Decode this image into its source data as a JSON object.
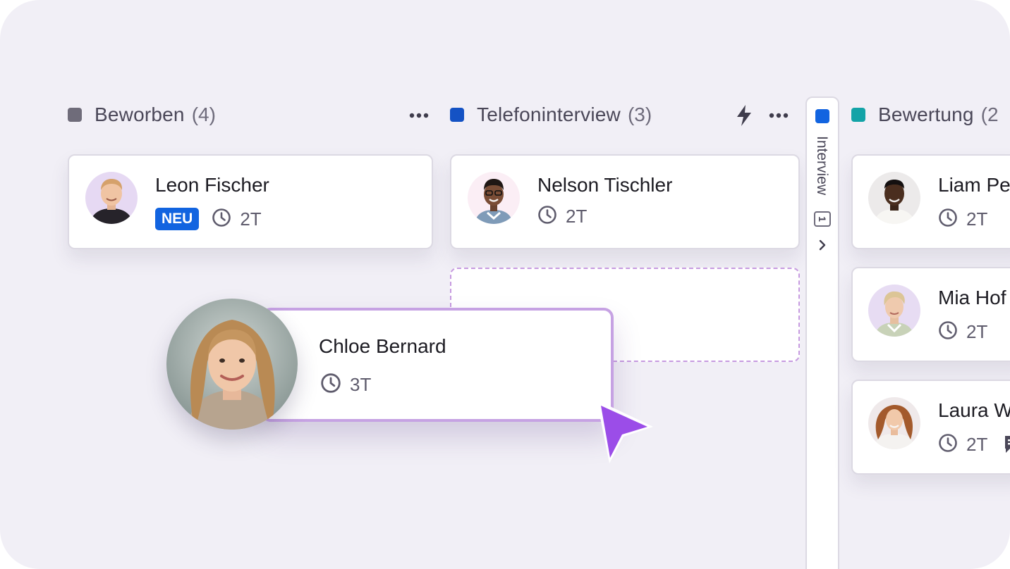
{
  "colors": {
    "background": "#f1eff6",
    "card": "#ffffff",
    "badge_blue": "#1264e0",
    "drag_outline": "#c6a2e3",
    "cursor": "#9b4de8"
  },
  "columns": [
    {
      "title": "Beworben",
      "count": "(4)",
      "color": "#6f6c7a",
      "menu_icon": "more-horizontal-icon",
      "cards": [
        {
          "name": "Leon Fischer",
          "badge": "NEU",
          "time_icon": "clock-icon",
          "days": "2T"
        }
      ]
    },
    {
      "title": "Telefoninterview",
      "count": "(3)",
      "color": "#1452c4",
      "automation_icon": "lightning-bolt-icon",
      "menu_icon": "more-horizontal-icon",
      "cards": [
        {
          "name": "Nelson Tischler",
          "time_icon": "clock-icon",
          "days": "2T"
        }
      ]
    },
    {
      "title": "Interview",
      "count": "1",
      "color": "#1264e0",
      "collapsed": true,
      "expand_icon": "chevron-right-icon"
    },
    {
      "title": "Bewertung",
      "count": "(2",
      "color": "#13a3a7",
      "cards": [
        {
          "name": "Liam Pe",
          "time_icon": "clock-icon",
          "days": "2T"
        },
        {
          "name": "Mia Hof",
          "time_icon": "clock-icon",
          "days": "2T"
        },
        {
          "name": "Laura W",
          "time_icon": "clock-icon",
          "days": "2T",
          "extra_icon": "comment-icon"
        }
      ]
    }
  ],
  "drag_card": {
    "name": "Chloe Bernard",
    "time_icon": "clock-icon",
    "days": "3T",
    "cursor_icon": "pointer-arrow-icon"
  }
}
